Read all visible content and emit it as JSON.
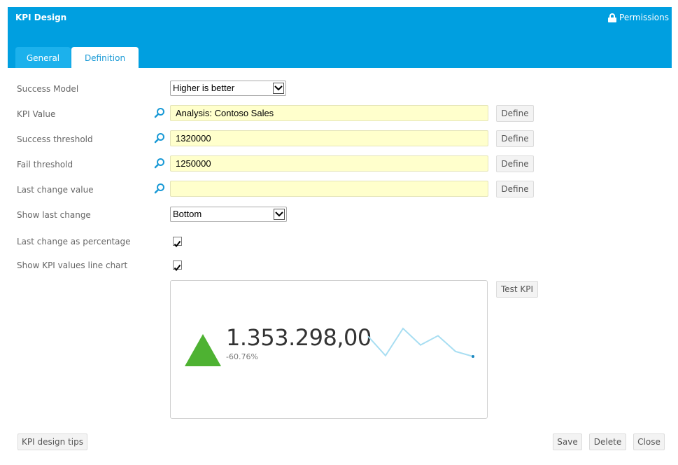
{
  "header": {
    "title": "KPI Design",
    "permissions_label": "Permissions",
    "accent_color": "#009fe0"
  },
  "tabs": [
    {
      "label": "General",
      "active": false
    },
    {
      "label": "Definition",
      "active": true
    }
  ],
  "form": {
    "success_model": {
      "label": "Success Model",
      "value": "Higher is better"
    },
    "kpi_value": {
      "label": "KPI Value",
      "value": "Analysis: Contoso Sales",
      "define_label": "Define",
      "icon": "search-icon"
    },
    "success_threshold": {
      "label": "Success threshold",
      "value": "1320000",
      "define_label": "Define",
      "icon": "search-icon"
    },
    "fail_threshold": {
      "label": "Fail threshold",
      "value": "1250000",
      "define_label": "Define",
      "icon": "search-icon"
    },
    "last_change_value": {
      "label": "Last change value",
      "value": "",
      "define_label": "Define",
      "icon": "search-icon"
    },
    "show_last_change": {
      "label": "Show last change",
      "value": "Bottom"
    },
    "last_change_as_percentage": {
      "label": "Last change as percentage",
      "checked": true
    },
    "show_line_chart": {
      "label": "Show KPI values line chart",
      "checked": true
    }
  },
  "preview": {
    "value": "1.353.298,00",
    "change": "-60.76%",
    "indicator": "up-triangle",
    "indicator_color": "#4eb232",
    "sparkline_color": "#a8def2",
    "sparkline_end_color": "#1a87c0",
    "test_button_label": "Test KPI"
  },
  "chart_data": {
    "type": "line",
    "title": "",
    "xlabel": "",
    "ylabel": "",
    "x": [
      1,
      2,
      3,
      4,
      5,
      6,
      7
    ],
    "values": [
      0.72,
      0.03,
      1.0,
      0.41,
      0.74,
      0.18,
      0.0
    ],
    "ylim": [
      0,
      1
    ],
    "grid": false,
    "legend": "none"
  },
  "footer": {
    "tips_label": "KPI design tips",
    "save_label": "Save",
    "delete_label": "Delete",
    "close_label": "Close"
  }
}
